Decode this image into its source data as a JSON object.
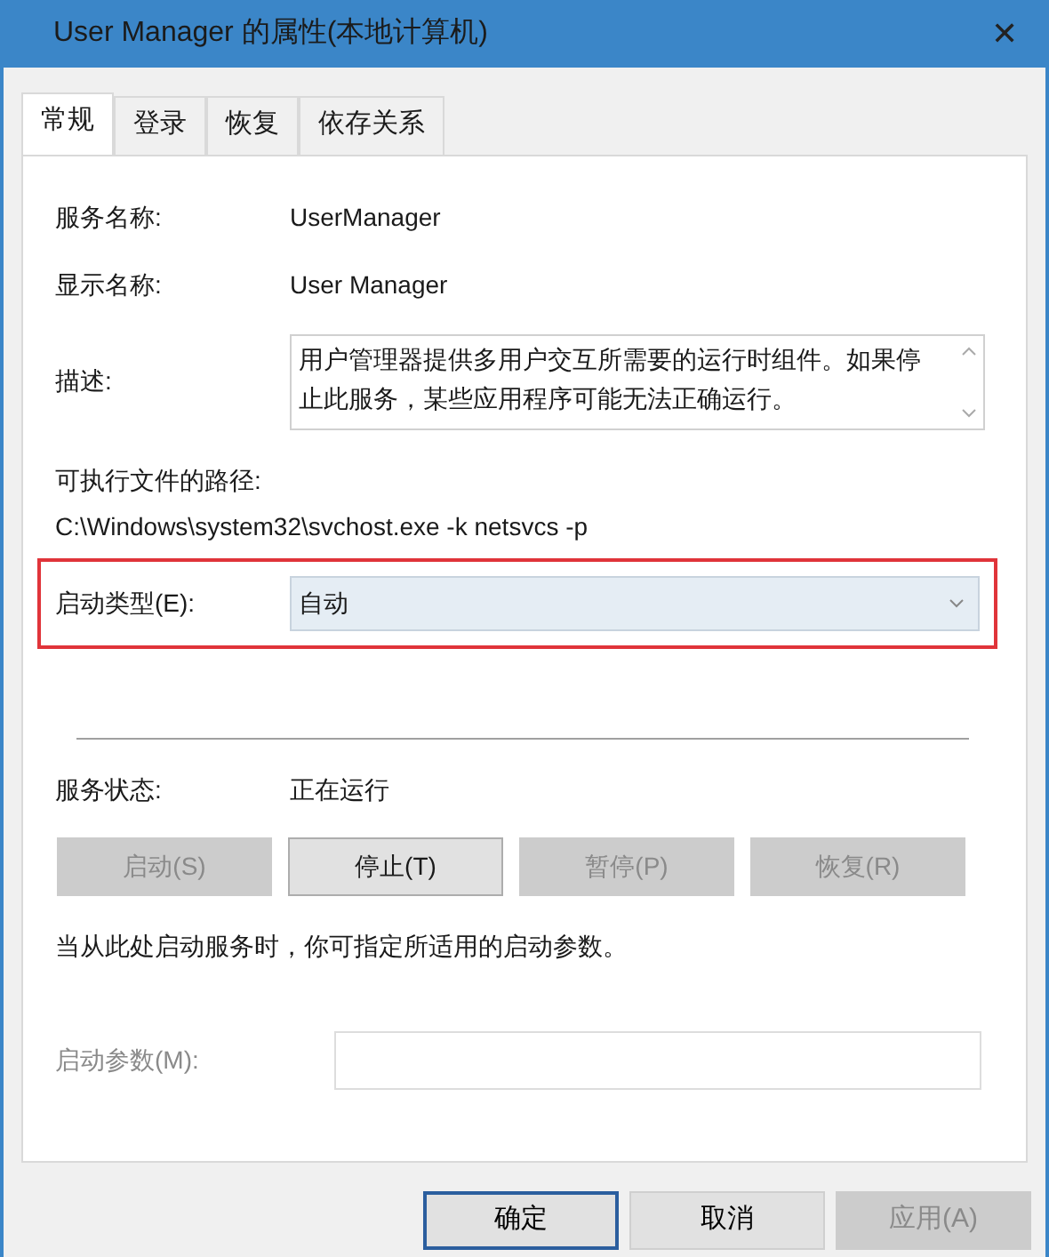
{
  "window": {
    "title": "User Manager 的属性(本地计算机)",
    "close": "✕"
  },
  "tabs": [
    {
      "label": "常规",
      "selected": true
    },
    {
      "label": "登录",
      "selected": false
    },
    {
      "label": "恢复",
      "selected": false
    },
    {
      "label": "依存关系",
      "selected": false
    }
  ],
  "service_name": {
    "label": "服务名称:",
    "value": "UserManager"
  },
  "display_name": {
    "label": "显示名称:",
    "value": "User Manager"
  },
  "description": {
    "label": "描述:",
    "value": "用户管理器提供多用户交互所需要的运行时组件。如果停止此服务，某些应用程序可能无法正确运行。"
  },
  "path": {
    "label": "可执行文件的路径:",
    "value": "C:\\Windows\\system32\\svchost.exe -k netsvcs -p"
  },
  "startup_type": {
    "label": "启动类型(E):",
    "value": "自动",
    "highlighted": true
  },
  "status": {
    "label": "服务状态:",
    "value": "正在运行"
  },
  "control_buttons": [
    {
      "label": "启动(S)",
      "disabled": true
    },
    {
      "label": "停止(T)",
      "disabled": false
    },
    {
      "label": "暂停(P)",
      "disabled": true
    },
    {
      "label": "恢复(R)",
      "disabled": true
    }
  ],
  "hint": "当从此处启动服务时，你可指定所适用的启动参数。",
  "start_params": {
    "label": "启动参数(M):",
    "disabled": true
  },
  "footer_buttons": [
    {
      "label": "确定",
      "disabled": false,
      "default": true
    },
    {
      "label": "取消",
      "disabled": false,
      "default": false
    },
    {
      "label": "应用(A)",
      "disabled": true,
      "default": false
    }
  ]
}
